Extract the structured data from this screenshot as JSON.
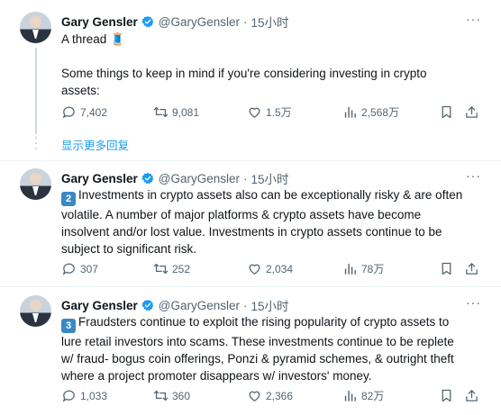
{
  "tweets": [
    {
      "name": "Gary Gensler",
      "handle": "@GaryGensler",
      "time": "15小时",
      "lines": [
        "A thread 🧵",
        "",
        "Some things to keep in mind if you're considering investing in crypto",
        "assets:"
      ],
      "replies": "7,402",
      "retweets": "9,081",
      "likes": "1.5万",
      "views": "2,568万"
    },
    {
      "name": "Gary Gensler",
      "handle": "@GaryGensler",
      "time": "15小时",
      "keycap": "2",
      "lines": [
        "Investments in crypto assets also can be exceptionally risky & are often",
        "volatile. A number of major platforms & crypto assets have become",
        "insolvent and/or lost value. Investments in crypto assets continue to be",
        "subject to significant risk."
      ],
      "replies": "307",
      "retweets": "252",
      "likes": "2,034",
      "views": "78万"
    },
    {
      "name": "Gary Gensler",
      "handle": "@GaryGensler",
      "time": "15小时",
      "keycap": "3",
      "lines": [
        "Fraudsters continue to exploit the rising popularity of crypto assets to",
        "lure retail investors into scams. These investments continue to be replete",
        "w/ fraud- bogus coin offerings, Ponzi & pyramid schemes, & outright theft",
        "where a project promoter disappears w/ investors' money."
      ],
      "replies": "1,033",
      "retweets": "360",
      "likes": "2,366",
      "views": "82万"
    }
  ],
  "show_more_label": "显示更多回复",
  "more_label": "···",
  "colors": {
    "link": "#1d9bf0",
    "verified": "#1d9bf0",
    "muted": "#536471"
  },
  "icons": [
    "reply-icon",
    "retweet-icon",
    "like-icon",
    "views-icon",
    "bookmark-icon",
    "share-icon",
    "verified-badge-icon",
    "more-icon",
    "thread-emoji",
    "keycap-icon"
  ]
}
